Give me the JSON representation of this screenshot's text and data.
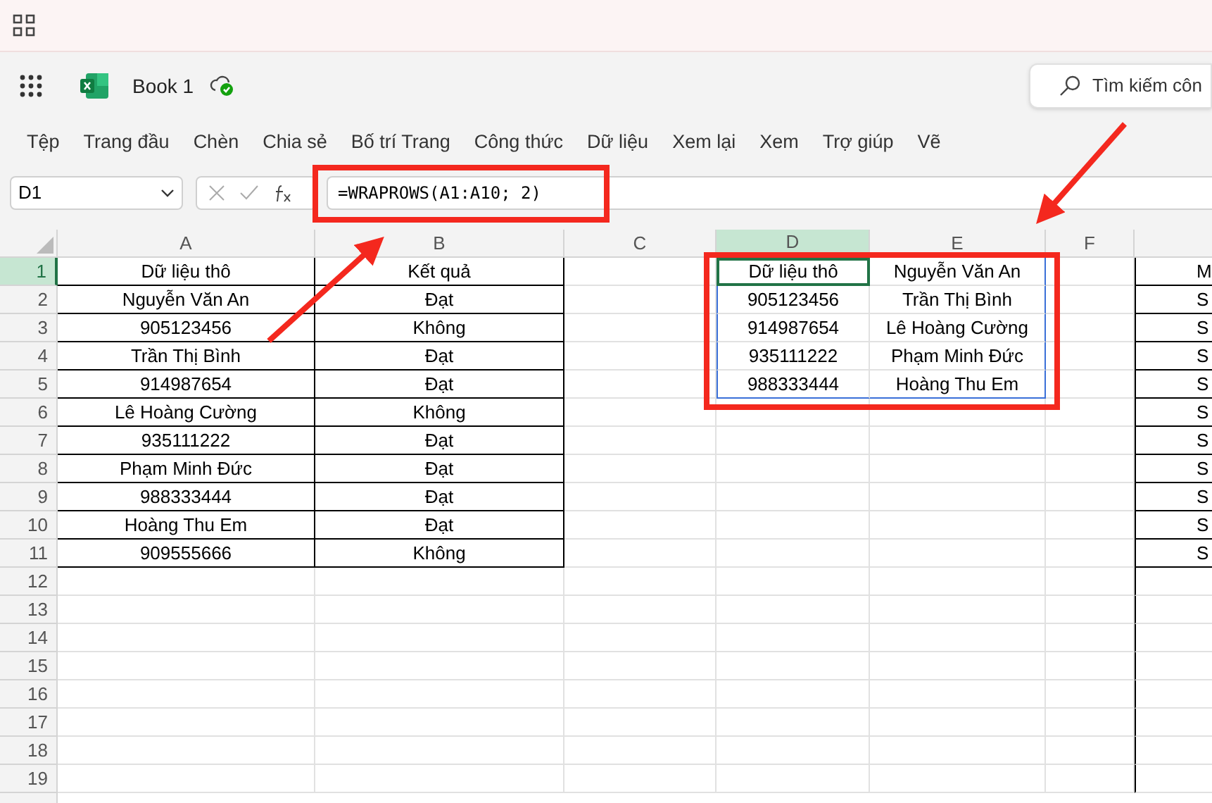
{
  "workbook": {
    "title": "Book 1"
  },
  "search": {
    "placeholder": "Tìm kiếm côn"
  },
  "menu": [
    "Tệp",
    "Trang đầu",
    "Chèn",
    "Chia sẻ",
    "Bố trí Trang",
    "Công thức",
    "Dữ liệu",
    "Xem lại",
    "Xem",
    "Trợ giúp",
    "Vẽ"
  ],
  "formula_bar": {
    "name_box": "D1",
    "formula": "=WRAPROWS(A1:A10; 2)"
  },
  "columns": [
    {
      "letter": "A",
      "selected": false
    },
    {
      "letter": "B",
      "selected": false
    },
    {
      "letter": "C",
      "selected": false
    },
    {
      "letter": "D",
      "selected": true
    },
    {
      "letter": "E",
      "selected": false
    },
    {
      "letter": "F",
      "selected": false
    }
  ],
  "row_headers": [
    {
      "number": "1",
      "selected": true
    },
    {
      "number": "2",
      "selected": false
    },
    {
      "number": "3",
      "selected": false
    },
    {
      "number": "4",
      "selected": false
    },
    {
      "number": "5",
      "selected": false
    },
    {
      "number": "6",
      "selected": false
    },
    {
      "number": "7",
      "selected": false
    },
    {
      "number": "8",
      "selected": false
    },
    {
      "number": "9",
      "selected": false
    },
    {
      "number": "10",
      "selected": false
    },
    {
      "number": "11",
      "selected": false
    },
    {
      "number": "12",
      "selected": false
    },
    {
      "number": "13",
      "selected": false
    },
    {
      "number": "14",
      "selected": false
    },
    {
      "number": "15",
      "selected": false
    },
    {
      "number": "16",
      "selected": false
    },
    {
      "number": "17",
      "selected": false
    },
    {
      "number": "18",
      "selected": false
    },
    {
      "number": "19",
      "selected": false
    }
  ],
  "source_table": [
    [
      "Dữ liệu thô",
      "Kết quả"
    ],
    [
      "Nguyễn Văn An",
      "Đạt"
    ],
    [
      "905123456",
      "Không"
    ],
    [
      "Trần Thị Bình",
      "Đạt"
    ],
    [
      "914987654",
      "Đạt"
    ],
    [
      "Lê Hoàng Cường",
      "Không"
    ],
    [
      "935111222",
      "Đạt"
    ],
    [
      "Phạm Minh Đức",
      "Đạt"
    ],
    [
      "988333444",
      "Đạt"
    ],
    [
      "Hoàng Thu Em",
      "Đạt"
    ],
    [
      "909555666",
      "Không"
    ]
  ],
  "result_range": [
    [
      "Dữ liệu thô",
      "Nguyễn Văn An"
    ],
    [
      "905123456",
      "Trần Thị Bình"
    ],
    [
      "914987654",
      "Lê Hoàng Cường"
    ],
    [
      "935111222",
      "Phạm Minh Đức"
    ],
    [
      "988333444",
      "Hoàng Thu Em"
    ]
  ],
  "cut_column": [
    "M",
    "S",
    "S",
    "S",
    "S",
    "S",
    "S",
    "S",
    "S",
    "S",
    "S"
  ]
}
